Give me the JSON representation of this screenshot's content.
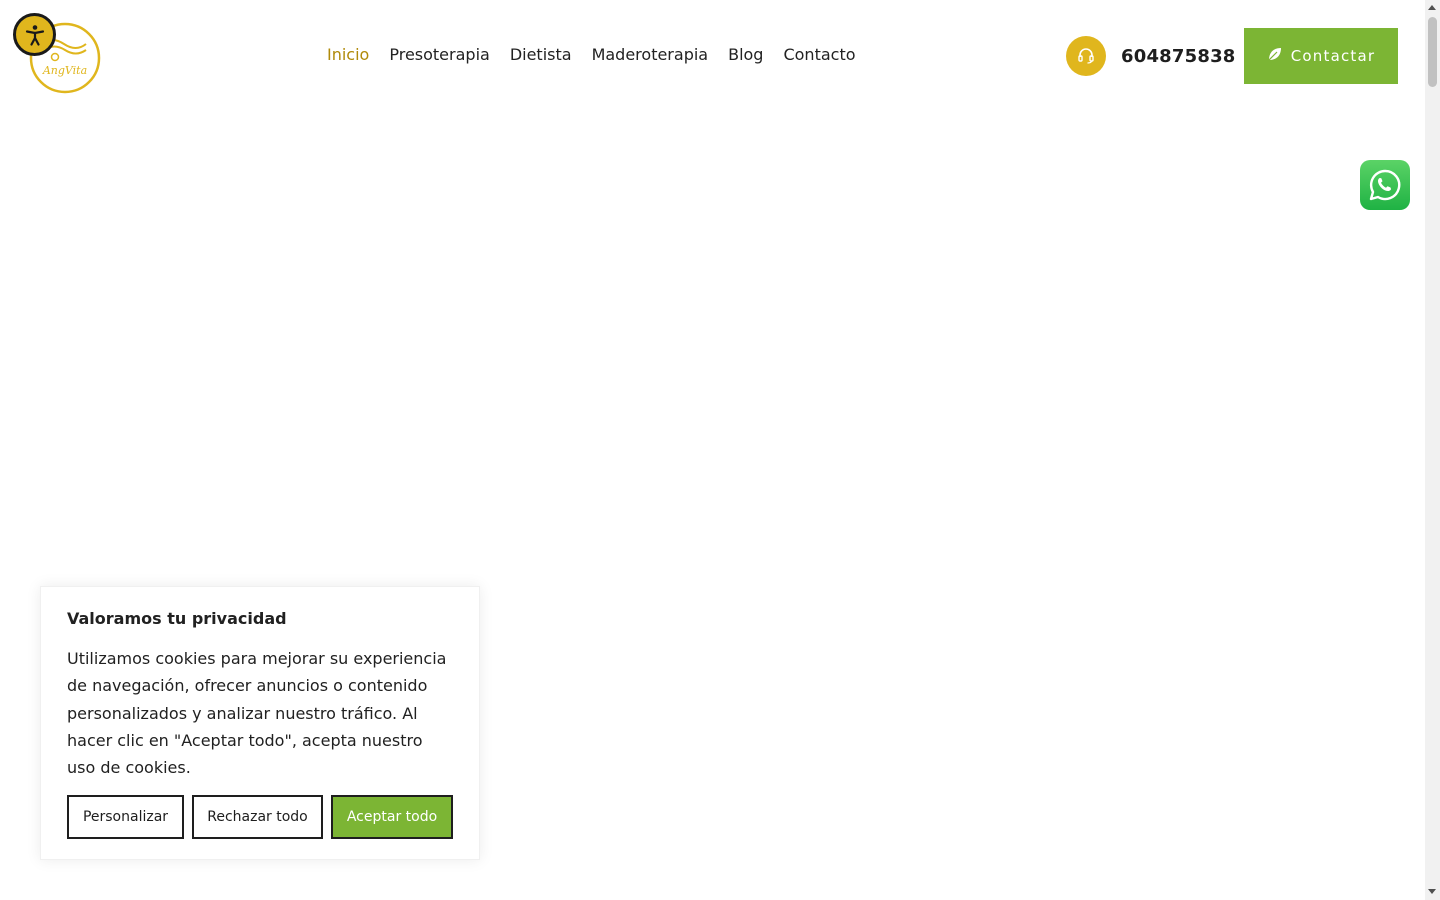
{
  "brand": {
    "logo_text": "AngVita",
    "accent_color": "#e0b61d",
    "green_color": "#7cb534",
    "active_nav_color": "#b08a0a"
  },
  "header": {
    "nav": [
      {
        "label": "Inicio",
        "active": true
      },
      {
        "label": "Presoterapia",
        "active": false
      },
      {
        "label": "Dietista",
        "active": false
      },
      {
        "label": "Maderoterapia",
        "active": false
      },
      {
        "label": "Blog",
        "active": false
      },
      {
        "label": "Contacto",
        "active": false
      }
    ],
    "phone": "604875838",
    "phone_icon": "headset-icon",
    "contact_button": "Contactar",
    "contact_icon": "leaf-icon"
  },
  "accessibility": {
    "icon": "accessibility-person-icon"
  },
  "whatsapp": {
    "icon": "whatsapp-icon"
  },
  "cookie": {
    "title": "Valoramos tu privacidad",
    "text": "Utilizamos cookies para mejorar su experiencia de navegación, ofrecer anuncios o contenido personalizados y analizar nuestro tráfico. Al hacer clic en \"Aceptar todo\", acepta nuestro uso de cookies.",
    "customize": "Personalizar",
    "reject": "Rechazar todo",
    "accept": "Aceptar todo"
  }
}
